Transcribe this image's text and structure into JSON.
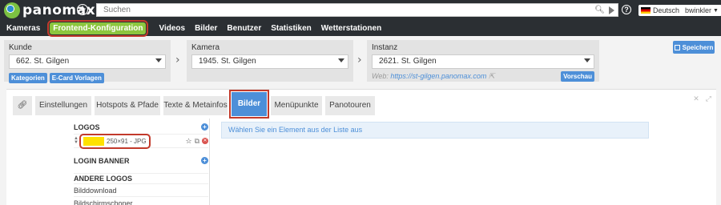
{
  "header": {
    "logo_text": "panomax",
    "search_placeholder": "Suchen",
    "language": "Deutsch",
    "user": "bwinkler"
  },
  "nav": {
    "items": [
      {
        "label": "Kameras",
        "active": false
      },
      {
        "label": "Frontend-Konfiguration",
        "active": true
      },
      {
        "label": "Videos",
        "active": false
      },
      {
        "label": "Bilder",
        "active": false
      },
      {
        "label": "Benutzer",
        "active": false
      },
      {
        "label": "Statistiken",
        "active": false
      },
      {
        "label": "Wetterstationen",
        "active": false
      }
    ]
  },
  "selector": {
    "kunde": {
      "label": "Kunde",
      "value": "662. St. Gilgen",
      "tags": [
        "Kategorien",
        "E-Card Vorlagen"
      ]
    },
    "kamera": {
      "label": "Kamera",
      "value": "1945. St. Gilgen"
    },
    "instanz": {
      "label": "Instanz",
      "value": "2621. St. Gilgen",
      "web_label": "Web:",
      "web_url": "https://st-gilgen.panomax.com",
      "tag": "Vorschau"
    },
    "save_label": "Speichern"
  },
  "tabs": [
    {
      "label": "Einstellungen"
    },
    {
      "label": "Hotspots & Pfade"
    },
    {
      "label": "Texte & Metainfos"
    },
    {
      "label": "Bilder"
    },
    {
      "label": "Menüpunkte"
    },
    {
      "label": "Panotouren"
    }
  ],
  "left_list": {
    "logos_head": "LOGOS",
    "logo_item_info": "250×91 - JPG",
    "login_banner_head": "LOGIN BANNER",
    "other_logos_head": "ANDERE LOGOS",
    "items": [
      "Bilddownload",
      "Bildschirmschoner"
    ]
  },
  "info_message": "Wählen Sie ein Element aus der Liste aus",
  "colors": {
    "header_bg": "#2b2f33",
    "active_nav": "#8cc63f",
    "accent": "#4d8fd8",
    "highlight_border": "#c23a2b"
  }
}
